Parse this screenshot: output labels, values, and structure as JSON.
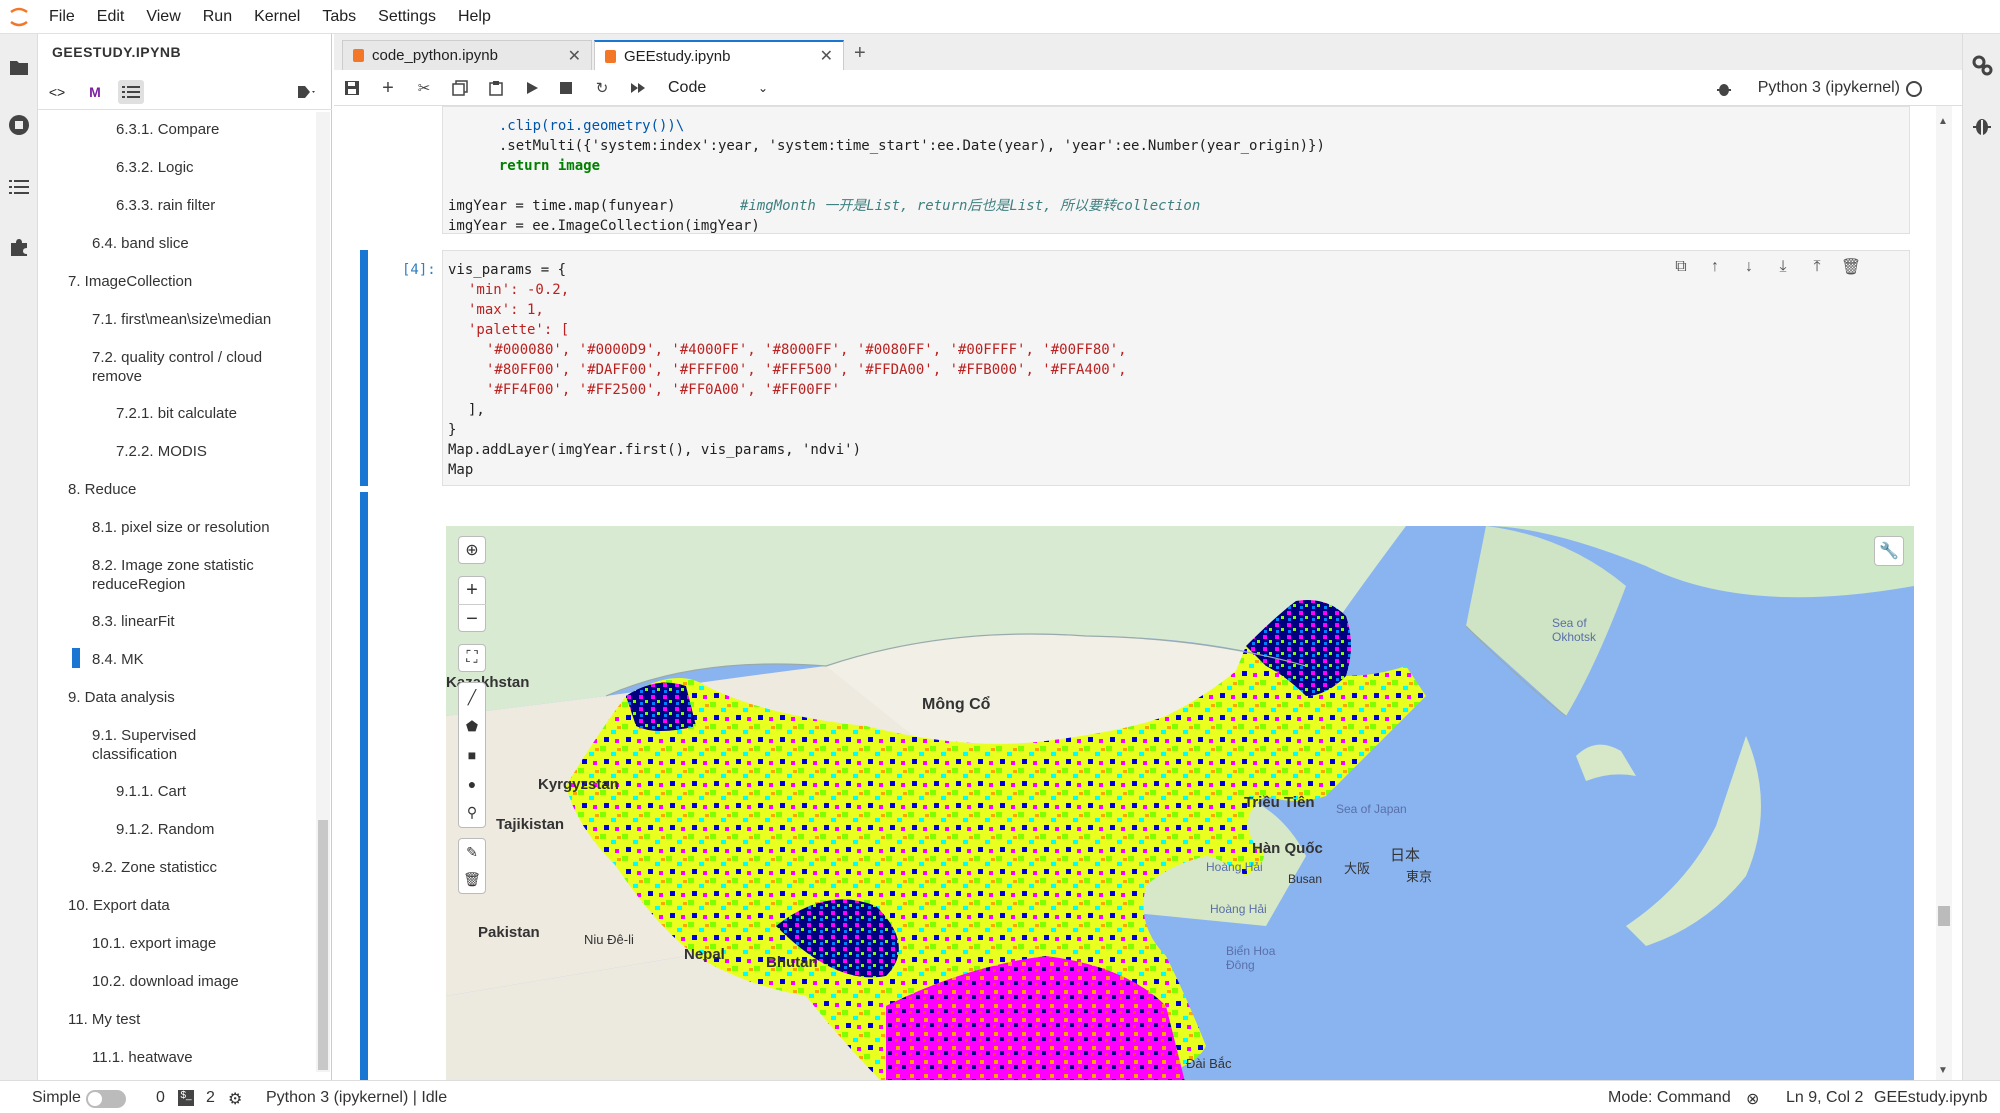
{
  "menubar": {
    "items": [
      "File",
      "Edit",
      "View",
      "Run",
      "Kernel",
      "Tabs",
      "Settings",
      "Help"
    ]
  },
  "toc": {
    "title": "GEESTUDY.IPYNB",
    "items": [
      "6.3.1. Compare",
      "6.3.2. Logic",
      "6.3.3. rain filter",
      "6.4. band slice",
      "7. ImageCollection",
      "7.1. first\\mean\\size\\median",
      "7.2. quality control / cloud",
      "remove",
      "7.2.1. bit calculate",
      "7.2.2. MODIS",
      "8. Reduce",
      "8.1. pixel size or resolution",
      "8.2. Image zone statistic",
      "reduceRegion",
      "8.3. linearFit",
      "8.4. MK",
      "9. Data analysis",
      "9.1. Supervised",
      "classification",
      "9.1.1. Cart",
      "9.1.2. Random",
      "9.2. Zone statisticc",
      "10. Export data",
      "10.1. export image",
      "10.2. download image",
      "11. My test",
      "11.1. heatwave"
    ]
  },
  "tabs": [
    {
      "label": "code_python.ipynb"
    },
    {
      "label": "GEEstudy.ipynb"
    }
  ],
  "toolbar": {
    "cell_type": "Code",
    "kernel": "Python 3 (ipykernel)"
  },
  "cells": {
    "prev": {
      "lines": [
        ".clip(roi.geometry())\\",
        ".setMulti({'system:index':year, 'system:time_start':ee.Date(year), 'year':ee.Number(year_origin)})",
        "return image",
        "imgYear = time.map(funyear)",
        "#imgMonth 一开是List, return后也是List, 所以要转collection",
        "imgYear = ee.ImageCollection(imgYear)"
      ]
    },
    "current": {
      "prompt": "[4]:",
      "lines": [
        "vis_params = {",
        "'min': -0.2,",
        "'max': 1,",
        "'palette': [",
        "'#000080', '#0000D9', '#4000FF', '#8000FF', '#0080FF', '#00FFFF', '#00FF80',",
        "'#80FF00', '#DAFF00', '#FFFF00', '#FFF500', '#FFDA00', '#FFB000', '#FFA400',",
        "'#FF4F00', '#FF2500', '#FF0A00', '#FF00FF'",
        "],",
        "}",
        "Map.addLayer(imgYear.first(), vis_params, 'ndvi')",
        "Map"
      ]
    }
  },
  "map": {
    "labels": {
      "kazakhstan": "Kazakhstan",
      "mongolia": "Mông Cổ",
      "kyrgyzstan": "Kyrgyzstan",
      "tajikistan": "Tajikistan",
      "pakistan": "Pakistan",
      "nepal": "Nepal",
      "bhutan": "Bhutan",
      "korea_n": "Triều Tiên",
      "korea_s": "Hàn Quốc",
      "sea_okhotsk": "Sea of Okhotsk",
      "sea_japan": "Sea of Japan",
      "yellow_sea": "Hoàng Hải",
      "east_china_sea": "Biển Hoa Đông",
      "busan": "Busan",
      "japan": "日本",
      "tokyo": "東京",
      "delhi": "Niu Đê-li",
      "taibei": "Đài Bắc",
      "osaka": "大阪"
    },
    "palette": [
      "#000080",
      "#0000D9",
      "#4000FF",
      "#8000FF",
      "#0080FF",
      "#00FFFF",
      "#00FF80",
      "#80FF00",
      "#DAFF00",
      "#FFFF00",
      "#FFF500",
      "#FFDA00",
      "#FFB000",
      "#FFA400",
      "#FF4F00",
      "#FF2500",
      "#FF0A00",
      "#FF00FF"
    ]
  },
  "status": {
    "mode_label": "Simple",
    "count1": "0",
    "count2": "2",
    "kernel_status": "Python 3 (ipykernel) | Idle",
    "mode": "Mode: Command",
    "position": "Ln 9, Col 2",
    "file": "GEEstudy.ipynb"
  }
}
